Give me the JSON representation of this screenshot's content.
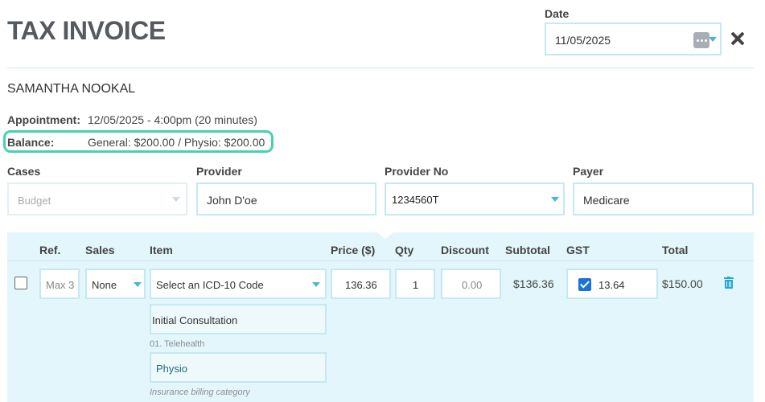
{
  "header": {
    "title": "TAX INVOICE",
    "date_label": "Date",
    "date_value": "11/05/2025"
  },
  "patient": {
    "name": "SAMANTHA NOOKAL"
  },
  "appointment": {
    "label": "Appointment:",
    "value": "12/05/2025 - 4:00pm (20 minutes)"
  },
  "balance": {
    "label": "Balance:",
    "value": "General: $200.00 / Physio: $200.00",
    "highlight_color": "#48d1b0"
  },
  "fields": {
    "cases": {
      "label": "Cases",
      "value": "Budget"
    },
    "provider": {
      "label": "Provider",
      "value": "John D'oe"
    },
    "provider_no": {
      "label": "Provider No",
      "value": "1234560T"
    },
    "payer": {
      "label": "Payer",
      "value": "Medicare"
    }
  },
  "table": {
    "headers": {
      "ref": "Ref.",
      "sales": "Sales",
      "item": "Item",
      "price": "Price ($)",
      "qty": "Qty",
      "discount": "Discount",
      "subtotal": "Subtotal",
      "gst": "GST",
      "total": "Total"
    },
    "row": {
      "ref": "Max 3",
      "sales": "None",
      "item_placeholder": "Select an ICD-10 Code",
      "price": "136.36",
      "qty": "1",
      "discount": "0.00",
      "subtotal": "$136.36",
      "gst_checked": true,
      "gst": "13.64",
      "total": "$150.00",
      "item_name": "Initial Consultation",
      "item_code_hint": "01. Telehealth",
      "billing_category": "Physio",
      "billing_category_hint": "Insurance billing category"
    }
  },
  "colors": {
    "accent": "#4ab5d4",
    "table_bg": "#e3f6fb",
    "checkbox": "#1a73d9"
  }
}
